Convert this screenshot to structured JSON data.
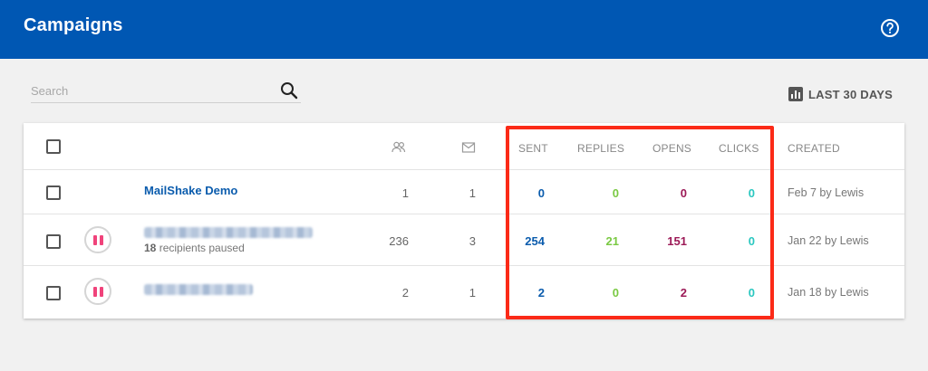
{
  "header": {
    "title": "Campaigns",
    "help_icon": "help-circle-icon"
  },
  "search": {
    "placeholder": "Search",
    "value": "",
    "icon": "search-icon"
  },
  "date_range": {
    "label": "LAST 30 DAYS",
    "icon": "bar-chart-icon"
  },
  "table": {
    "columns": {
      "recipients_icon": "people-icon",
      "messages_icon": "mail-icon",
      "sent": "SENT",
      "replies": "REPLIES",
      "opens": "OPENS",
      "clicks": "CLICKS",
      "created": "CREATED"
    },
    "rows": [
      {
        "name": "MailShake Demo",
        "recipients": "1",
        "messages": "1",
        "sent": "0",
        "replies": "0",
        "opens": "0",
        "clicks": "0",
        "created": "Feb 7 by Lewis"
      },
      {
        "name_blurred": true,
        "paused_count": "18",
        "paused_text": " recipients paused",
        "recipients": "236",
        "messages": "3",
        "sent": "254",
        "replies": "21",
        "opens": "151",
        "clicks": "0",
        "created": "Jan 22 by Lewis"
      },
      {
        "name_blurred": true,
        "recipients": "2",
        "messages": "1",
        "sent": "2",
        "replies": "0",
        "opens": "2",
        "clicks": "0",
        "created": "Jan 18 by Lewis"
      }
    ]
  },
  "colors": {
    "topbar": "#0057b3",
    "sent": "#0b5cad",
    "replies": "#7ac943",
    "opens": "#9c1a57",
    "clicks": "#2ac7c0",
    "pause": "#f0437b",
    "highlight": "#fb2a17"
  }
}
